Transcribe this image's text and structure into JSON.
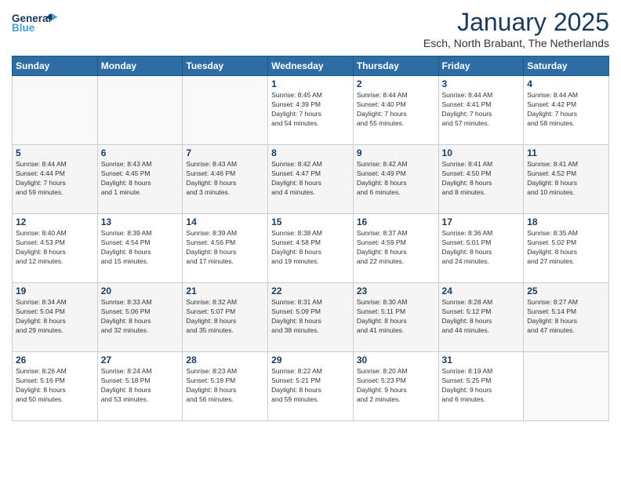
{
  "header": {
    "logo_general": "General",
    "logo_blue": "Blue",
    "month_title": "January 2025",
    "location": "Esch, North Brabant, The Netherlands"
  },
  "days_of_week": [
    "Sunday",
    "Monday",
    "Tuesday",
    "Wednesday",
    "Thursday",
    "Friday",
    "Saturday"
  ],
  "weeks": [
    [
      {
        "day": "",
        "info": ""
      },
      {
        "day": "",
        "info": ""
      },
      {
        "day": "",
        "info": ""
      },
      {
        "day": "1",
        "info": "Sunrise: 8:45 AM\nSunset: 4:39 PM\nDaylight: 7 hours\nand 54 minutes."
      },
      {
        "day": "2",
        "info": "Sunrise: 8:44 AM\nSunset: 4:40 PM\nDaylight: 7 hours\nand 55 minutes."
      },
      {
        "day": "3",
        "info": "Sunrise: 8:44 AM\nSunset: 4:41 PM\nDaylight: 7 hours\nand 57 minutes."
      },
      {
        "day": "4",
        "info": "Sunrise: 8:44 AM\nSunset: 4:42 PM\nDaylight: 7 hours\nand 58 minutes."
      }
    ],
    [
      {
        "day": "5",
        "info": "Sunrise: 8:44 AM\nSunset: 4:44 PM\nDaylight: 7 hours\nand 59 minutes."
      },
      {
        "day": "6",
        "info": "Sunrise: 8:43 AM\nSunset: 4:45 PM\nDaylight: 8 hours\nand 1 minute."
      },
      {
        "day": "7",
        "info": "Sunrise: 8:43 AM\nSunset: 4:46 PM\nDaylight: 8 hours\nand 3 minutes."
      },
      {
        "day": "8",
        "info": "Sunrise: 8:42 AM\nSunset: 4:47 PM\nDaylight: 8 hours\nand 4 minutes."
      },
      {
        "day": "9",
        "info": "Sunrise: 8:42 AM\nSunset: 4:49 PM\nDaylight: 8 hours\nand 6 minutes."
      },
      {
        "day": "10",
        "info": "Sunrise: 8:41 AM\nSunset: 4:50 PM\nDaylight: 8 hours\nand 8 minutes."
      },
      {
        "day": "11",
        "info": "Sunrise: 8:41 AM\nSunset: 4:52 PM\nDaylight: 8 hours\nand 10 minutes."
      }
    ],
    [
      {
        "day": "12",
        "info": "Sunrise: 8:40 AM\nSunset: 4:53 PM\nDaylight: 8 hours\nand 12 minutes."
      },
      {
        "day": "13",
        "info": "Sunrise: 8:39 AM\nSunset: 4:54 PM\nDaylight: 8 hours\nand 15 minutes."
      },
      {
        "day": "14",
        "info": "Sunrise: 8:39 AM\nSunset: 4:56 PM\nDaylight: 8 hours\nand 17 minutes."
      },
      {
        "day": "15",
        "info": "Sunrise: 8:38 AM\nSunset: 4:58 PM\nDaylight: 8 hours\nand 19 minutes."
      },
      {
        "day": "16",
        "info": "Sunrise: 8:37 AM\nSunset: 4:59 PM\nDaylight: 8 hours\nand 22 minutes."
      },
      {
        "day": "17",
        "info": "Sunrise: 8:36 AM\nSunset: 5:01 PM\nDaylight: 8 hours\nand 24 minutes."
      },
      {
        "day": "18",
        "info": "Sunrise: 8:35 AM\nSunset: 5:02 PM\nDaylight: 8 hours\nand 27 minutes."
      }
    ],
    [
      {
        "day": "19",
        "info": "Sunrise: 8:34 AM\nSunset: 5:04 PM\nDaylight: 8 hours\nand 29 minutes."
      },
      {
        "day": "20",
        "info": "Sunrise: 8:33 AM\nSunset: 5:06 PM\nDaylight: 8 hours\nand 32 minutes."
      },
      {
        "day": "21",
        "info": "Sunrise: 8:32 AM\nSunset: 5:07 PM\nDaylight: 8 hours\nand 35 minutes."
      },
      {
        "day": "22",
        "info": "Sunrise: 8:31 AM\nSunset: 5:09 PM\nDaylight: 8 hours\nand 38 minutes."
      },
      {
        "day": "23",
        "info": "Sunrise: 8:30 AM\nSunset: 5:11 PM\nDaylight: 8 hours\nand 41 minutes."
      },
      {
        "day": "24",
        "info": "Sunrise: 8:28 AM\nSunset: 5:12 PM\nDaylight: 8 hours\nand 44 minutes."
      },
      {
        "day": "25",
        "info": "Sunrise: 8:27 AM\nSunset: 5:14 PM\nDaylight: 8 hours\nand 47 minutes."
      }
    ],
    [
      {
        "day": "26",
        "info": "Sunrise: 8:26 AM\nSunset: 5:16 PM\nDaylight: 8 hours\nand 50 minutes."
      },
      {
        "day": "27",
        "info": "Sunrise: 8:24 AM\nSunset: 5:18 PM\nDaylight: 8 hours\nand 53 minutes."
      },
      {
        "day": "28",
        "info": "Sunrise: 8:23 AM\nSunset: 5:19 PM\nDaylight: 8 hours\nand 56 minutes."
      },
      {
        "day": "29",
        "info": "Sunrise: 8:22 AM\nSunset: 5:21 PM\nDaylight: 8 hours\nand 59 minutes."
      },
      {
        "day": "30",
        "info": "Sunrise: 8:20 AM\nSunset: 5:23 PM\nDaylight: 9 hours\nand 2 minutes."
      },
      {
        "day": "31",
        "info": "Sunrise: 8:19 AM\nSunset: 5:25 PM\nDaylight: 9 hours\nand 6 minutes."
      },
      {
        "day": "",
        "info": ""
      }
    ]
  ]
}
